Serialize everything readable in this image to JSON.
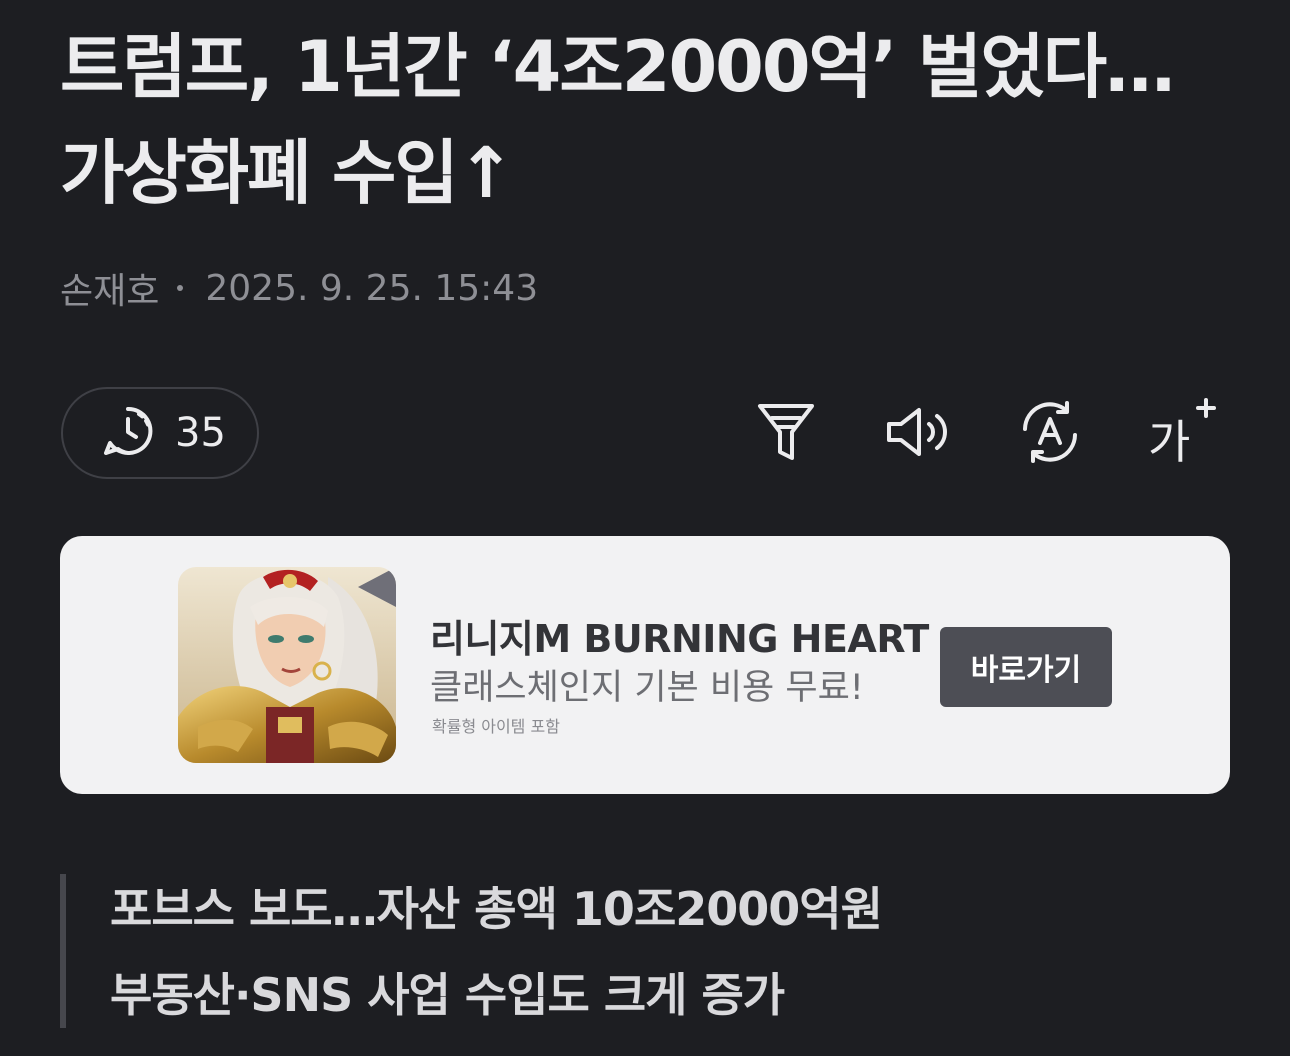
{
  "article": {
    "headline_line1": "트럼프, 1년간 ‘4조2000억’ 벌었다…",
    "headline_line2": "가상화폐 수입↑",
    "author": "손재호",
    "datetime": "2025. 9. 25. 15:43"
  },
  "toolbar": {
    "comment_count": "35",
    "font_size_glyph": "가",
    "icons": [
      "comment-clock-icon",
      "summary-filter-icon",
      "speaker-icon",
      "translate-icon",
      "font-size-icon"
    ]
  },
  "ad": {
    "title": "리니지M BURNING HEART",
    "description": "클래스체인지 기본 비용 무료!",
    "note": "확률형 아이템 포함",
    "button_label": "바로가기"
  },
  "subheadlines": [
    "포브스 보도…자산 총액 10조2000억원",
    "부동산·SNS 사업 수입도 크게 증가"
  ]
}
